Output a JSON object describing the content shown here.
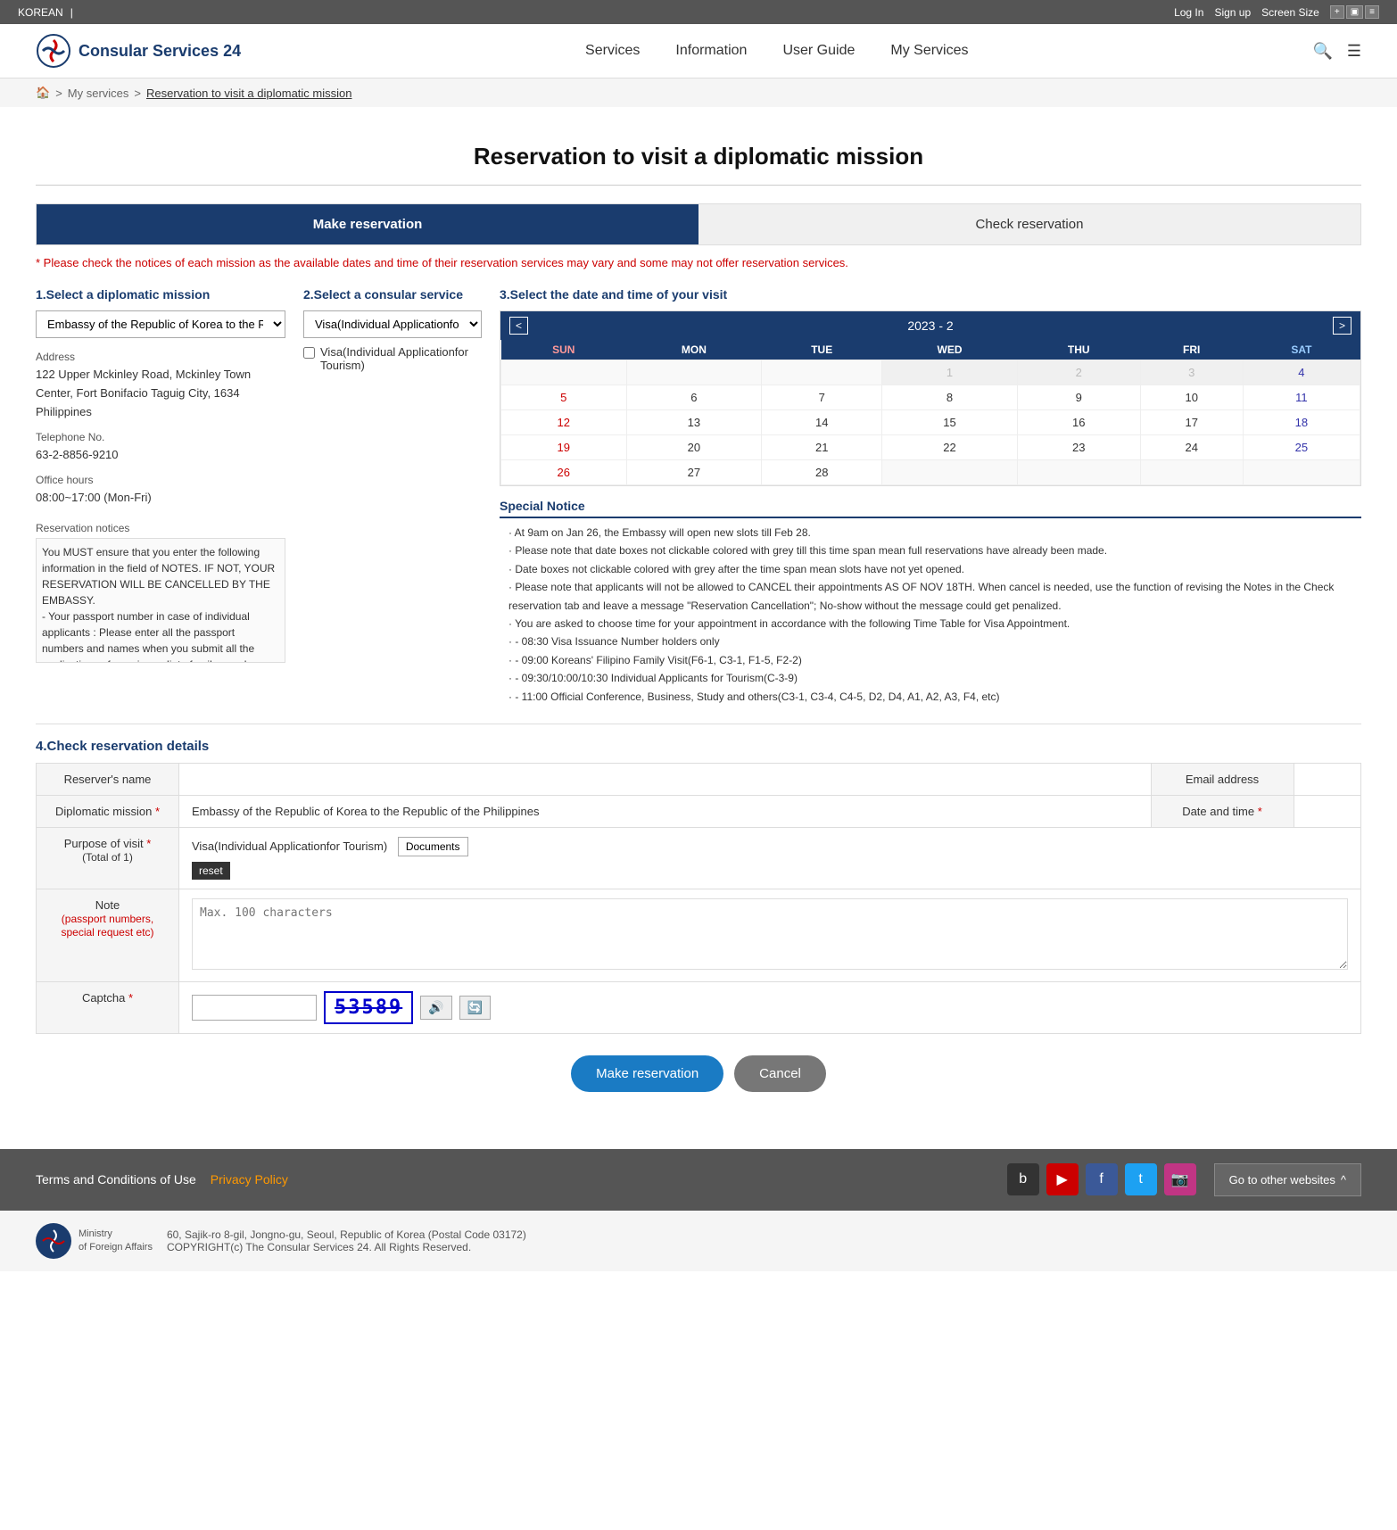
{
  "topbar": {
    "language": "KOREAN",
    "login": "Log In",
    "signup": "Sign up",
    "screensize": "Screen Size"
  },
  "nav": {
    "brand": "Consular Services 24",
    "links": [
      "Services",
      "Information",
      "User Guide",
      "My Services"
    ]
  },
  "breadcrumb": {
    "home": "🏠",
    "myservices": "My services",
    "current": "Reservation to visit a diplomatic mission"
  },
  "page": {
    "title": "Reservation to visit a diplomatic mission",
    "tabs": [
      "Make reservation",
      "Check reservation"
    ],
    "notice": "* Please check the notices of each mission as the available dates and time of their reservation services may vary and some may not offer reservation services."
  },
  "section1": {
    "title": "1.Select a diplomatic mission",
    "dropdown": "Embassy of the Republic of Korea to the Republic",
    "address_label": "Address",
    "address": "122 Upper Mckinley Road, Mckinley Town Center, Fort Bonifacio Taguig City, 1634 Philippines",
    "telephone_label": "Telephone No.",
    "telephone": "63-2-8856-9210",
    "office_hours_label": "Office hours",
    "office_hours": "08:00~17:00 (Mon-Fri)",
    "reservation_notices_label": "Reservation notices",
    "reservation_notices": "You MUST ensure that you enter the following information in the field of NOTES. IF NOT, YOUR RESERVATION WILL BE CANCELLED BY THE EMBASSY.\n- Your passport number in case of individual applicants : Please enter all the passport numbers and names when you submit all the applications of your immediate family members, exclusively the applicant's parents, spouse and minor children only EXCLUDING siblings(maximum 5 people including the applicant, the number may vary for different"
  },
  "section2": {
    "title": "2.Select a consular service",
    "dropdown": "Visa(Individual Applicationfor ▼",
    "service_label": "Visa(Individual Applicationfor Tourism)"
  },
  "section3": {
    "title": "3.Select the date and time of your visit",
    "calendar": {
      "month": "2023 - 2",
      "headers": [
        "SUN",
        "MON",
        "TUE",
        "WED",
        "THU",
        "FRI",
        "SAT"
      ],
      "weeks": [
        [
          "",
          "",
          "",
          "1",
          "2",
          "3",
          "4"
        ],
        [
          "5",
          "6",
          "7",
          "8",
          "9",
          "10",
          "11"
        ],
        [
          "12",
          "13",
          "14",
          "15",
          "16",
          "17",
          "18"
        ],
        [
          "19",
          "20",
          "21",
          "22",
          "23",
          "24",
          "25"
        ],
        [
          "26",
          "27",
          "28",
          "",
          "",
          "",
          ""
        ]
      ]
    },
    "special_notice_title": "Special Notice",
    "special_notices": [
      "At 9am on Jan 26, the Embassy will open new slots till Feb 28.",
      "Please note that date boxes not clickable colored with grey till this time span mean full reservations have already been made.",
      "Date boxes not clickable colored with grey after the time span mean slots have not yet opened.",
      "Please note that applicants will not be allowed to CANCEL their appointments AS OF NOV 18TH. When cancel is needed, use the function of revising the Notes in the Check reservation tab and leave a message \"Reservation Cancellation\"; No-show without the message could get penalized.",
      "You are asked to choose time for your appointment in accordance with the following Time Table for Visa Appointment.",
      "- 08:30   Visa Issuance Number holders only",
      "- 09:00   Koreans' Filipino Family Visit(F6-1, C3-1, F1-5, F2-2)",
      "- 09:30/10:00/10:30 Individual Applicants for Tourism(C-3-9)",
      "- 11:00   Official Conference, Business, Study and others(C3-1, C3-4, C4-5, D2, D4, A1, A2, A3, F4, etc)"
    ]
  },
  "section4": {
    "title": "4.Check reservation details",
    "fields": {
      "reserver_name_label": "Reserver's name",
      "email_label": "Email address",
      "diplomatic_mission_label": "Diplomatic mission",
      "diplomatic_mission_value": "Embassy of the Republic of Korea to the Republic of the Philippines",
      "date_time_label": "Date and time",
      "purpose_label": "Purpose of visit",
      "purpose_sub": "(Total of 1)",
      "purpose_value": "Visa(Individual Applicationfor Tourism)",
      "documents_btn": "Documents",
      "reset_btn": "reset",
      "note_label": "Note",
      "note_sublabel": "(passport numbers, special request etc)",
      "note_placeholder": "Max. 100 characters",
      "captcha_label": "Captcha",
      "captcha_value": "53589"
    }
  },
  "buttons": {
    "make_reservation": "Make reservation",
    "cancel": "Cancel"
  },
  "footer": {
    "terms": "Terms and Conditions of Use",
    "privacy": "Privacy Policy",
    "goto": "Go to other websites",
    "address": "60, Sajik-ro 8-gil, Jongno-gu, Seoul, Republic of Korea (Postal Code 03172)",
    "copyright": "COPYRIGHT(c) The Consular Services 24. All Rights Reserved.",
    "ministry": "Ministry\nof Foreign Affairs"
  }
}
